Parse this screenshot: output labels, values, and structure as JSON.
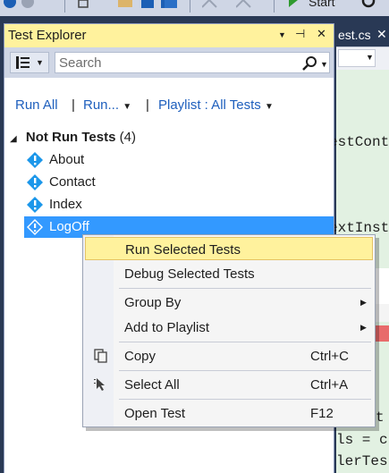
{
  "toolbar": {
    "start_label": "Start"
  },
  "editor": {
    "tab_label": "est.cs",
    "code_fragments": [
      "estCont",
      "extInst",
      "t",
      "ls = cl",
      "lerTest"
    ]
  },
  "test_explorer": {
    "title": "Test Explorer",
    "search": {
      "placeholder": "Search"
    },
    "commands": {
      "run_all": "Run All",
      "run": "Run...",
      "playlist": "Playlist : All Tests"
    },
    "group": {
      "label": "Not Run Tests",
      "count": "(4)"
    },
    "tests": [
      {
        "name": "About",
        "selected": false
      },
      {
        "name": "Contact",
        "selected": false
      },
      {
        "name": "Index",
        "selected": false
      },
      {
        "name": "LogOff",
        "selected": true
      }
    ]
  },
  "context_menu": {
    "items": [
      {
        "label": "Run Selected Tests",
        "shortcut": "",
        "submenu": false,
        "icon": "",
        "highlighted": true
      },
      {
        "label": "Debug Selected Tests",
        "shortcut": "",
        "submenu": false,
        "icon": "",
        "highlighted": false
      },
      {
        "label": "Group By",
        "shortcut": "",
        "submenu": true,
        "icon": "",
        "highlighted": false
      },
      {
        "label": "Add to Playlist",
        "shortcut": "",
        "submenu": true,
        "icon": "",
        "highlighted": false
      },
      {
        "label": "Copy",
        "shortcut": "Ctrl+C",
        "submenu": false,
        "icon": "copy-icon",
        "highlighted": false
      },
      {
        "label": "Select All",
        "shortcut": "Ctrl+A",
        "submenu": false,
        "icon": "select-all-icon",
        "highlighted": false
      },
      {
        "label": "Open Test",
        "shortcut": "F12",
        "submenu": false,
        "icon": "",
        "highlighted": false
      }
    ]
  },
  "colors": {
    "title_bar": "#fff29d",
    "selection": "#3399ff",
    "link": "#1e5fbd",
    "not_run_icon": "#1c97ea",
    "editor_bg": "#e2f1e2"
  }
}
